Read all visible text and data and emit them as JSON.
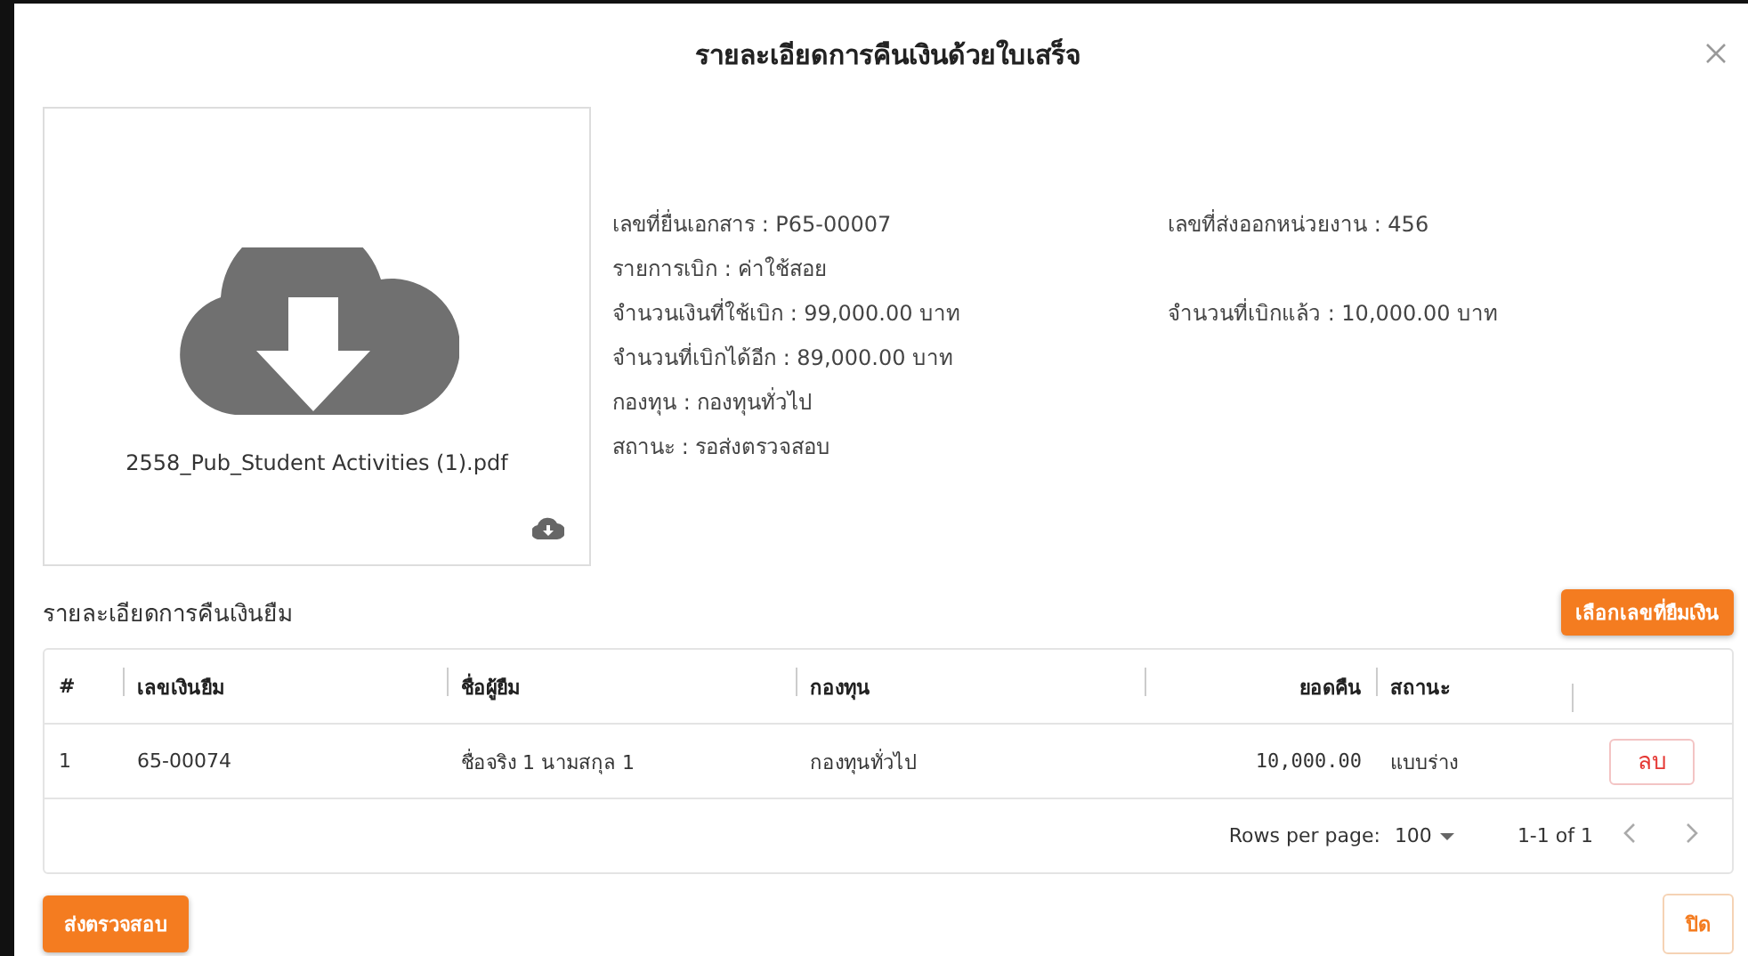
{
  "dialog": {
    "title": "รายละเอียดการคืนเงินด้วยใบเสร็จ"
  },
  "attachment": {
    "file_name": "2558_Pub_Student Activities (1).pdf"
  },
  "details": [
    {
      "left": "เลขที่ยื่นเอกสาร : P65-00007",
      "right": "เลขที่ส่งออกหน่วยงาน : 456"
    },
    {
      "left": "รายการเบิก : ค่าใช้สอย"
    },
    {
      "left": "จำนวนเงินที่ใช้เบิก : 99,000.00 บาท",
      "right": "จำนวนที่เบิกแล้ว : 10,000.00 บาท"
    },
    {
      "left": "จำนวนที่เบิกได้อีก : 89,000.00 บาท"
    },
    {
      "left": "กองทุน : กองทุนทั่วไป"
    },
    {
      "left": "สถานะ : รอส่งตรวจสอบ"
    }
  ],
  "section": {
    "title": "รายละเอียดการคืนเงินยืม",
    "action": "เลือกเลขที่ยืมเงิน"
  },
  "table": {
    "columns": [
      "#",
      "เลขเงินยืม",
      "ชื่อผู้ยืม",
      "กองทุน",
      "ยอดคืน",
      "สถานะ"
    ],
    "rows": [
      {
        "cells": [
          "1",
          "65-00074",
          "ชื่อจริง 1 นามสกุล 1",
          "กองทุนทั่วไป",
          "10,000.00",
          "แบบร่าง"
        ],
        "action": "ลบ"
      }
    ],
    "footer": {
      "rows_per_page_label": "Rows per page:",
      "rows_per_page": "100",
      "range": "1-1 of 1"
    }
  },
  "buttons": {
    "submit": "ส่งตรวจสอบ",
    "close": "ปิด"
  }
}
